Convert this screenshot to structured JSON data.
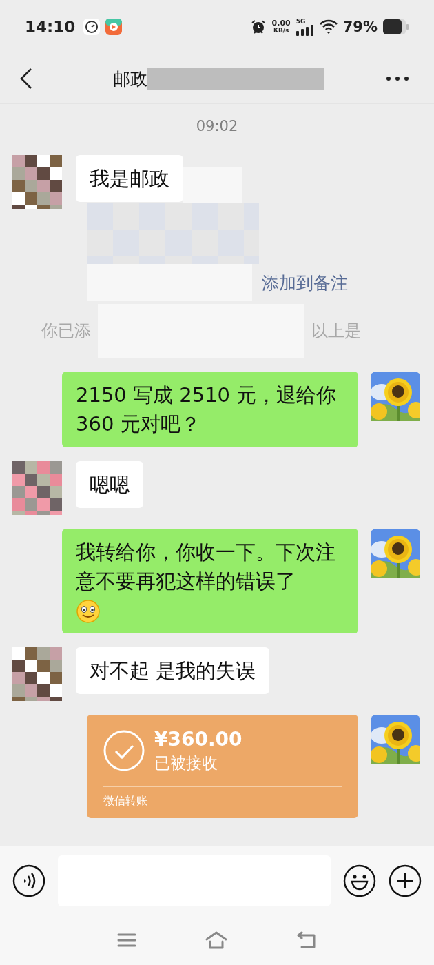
{
  "status_bar": {
    "time": "14:10",
    "net_speed": "0.00",
    "net_unit": "KB/s",
    "network": "5G",
    "battery": "79%"
  },
  "header": {
    "title": "邮政"
  },
  "messages": [
    {
      "kind": "time",
      "text": "09:02"
    },
    {
      "kind": "text",
      "from_me": false,
      "text": "我是邮政"
    },
    {
      "kind": "link",
      "text": "添加到备注"
    },
    {
      "kind": "notice",
      "left": "你已添",
      "right": "以上是"
    },
    {
      "kind": "text",
      "from_me": true,
      "text": "2150 写成 2510 元，退给你 360 元对吧？"
    },
    {
      "kind": "text",
      "from_me": false,
      "text": "嗯嗯"
    },
    {
      "kind": "text",
      "from_me": true,
      "text": "我转给你，你收一下。下次注意不要再犯这样的错误了",
      "emoji": true
    },
    {
      "kind": "text",
      "from_me": false,
      "text": "对不起 是我的失误"
    },
    {
      "kind": "transfer",
      "from_me": true,
      "amount": "¥360.00",
      "status": "已被接收",
      "footer": "微信转账"
    }
  ]
}
